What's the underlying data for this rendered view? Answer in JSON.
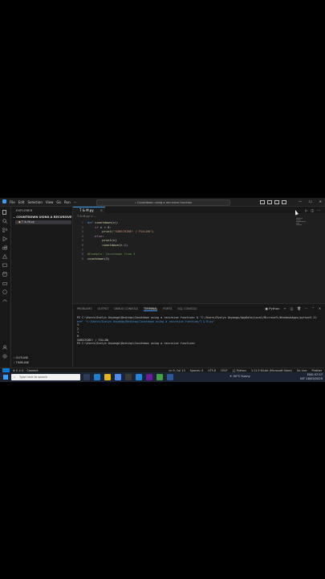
{
  "window": {
    "menu": [
      "File",
      "Edit",
      "Selection",
      "View",
      "Go",
      "Run",
      "···"
    ],
    "command_center": "Countdown using a recursive function",
    "controls": [
      "—",
      "☐",
      "✕"
    ]
  },
  "sidebar": {
    "title": "EXPLORER",
    "folder": "COUNTDOWN USING A RECURSIVE FUNCTI...",
    "file": "T & M.py",
    "outline": "OUTLINE",
    "timeline": "TIMELINE"
  },
  "editor": {
    "tab": "T & M.py",
    "tab_close": "×",
    "breadcrumb": "T & M.py > ...",
    "lines": [
      {
        "n": "1"
      },
      {
        "n": "2"
      },
      {
        "n": "3"
      },
      {
        "n": "4"
      },
      {
        "n": "5"
      },
      {
        "n": "6"
      },
      {
        "n": "7"
      },
      {
        "n": "8"
      },
      {
        "n": "9"
      }
    ],
    "code": {
      "l1_kw": "def ",
      "l1_fn": "countdown",
      "l1_rest": "(n):",
      "l2_kw": "if ",
      "l2_var": "n",
      "l2_op": " < ",
      "l2_num": "0",
      "l2_end": ":",
      "l3_fn": "print",
      "l3_open": "(",
      "l3_str": "\"SUBSCRIBE! / FOLLOW\"",
      "l3_close": ")",
      "l4_kw": "else",
      ":": ":",
      "l5_fn": "print",
      "l5_rest": "(n)",
      "l6_fn": "countdown",
      "l6_rest": "(n-1)",
      "l8_cm": "#Example: Countdown from 3",
      "l9_fn": "countdown",
      "l9_rest": "(3)"
    }
  },
  "panel": {
    "tabs": [
      "PROBLEMS",
      "OUTPUT",
      "DEBUG CONSOLE",
      "TERMINAL",
      "PORTS",
      "SQL CONSOLE"
    ],
    "active_tab": "TERMINAL",
    "shell": "Python",
    "terminal": [
      "PS C:\\Users\\Evelyn Onyango\\Desktop\\Countdown using a recursive function> & \"C:/Users/Evelyn Onyango/AppData/Local/Microsoft/WindowsApps/python3.11.",
      "exe\" \"c:/Users/Evelyn Onyango/Desktop/Countdown using a recursive function/T & M.py\"",
      "3",
      "2",
      "1",
      "0",
      "SUBSCRIBE! / FOLLOW",
      "PS C:\\Users\\Evelyn Onyango\\Desktop\\Countdown using a recursive function>"
    ]
  },
  "statusbar": {
    "left": [
      "⊗ 0 ⚠ 0",
      "Connect"
    ],
    "right": [
      "Ln 9, Col 13",
      "Spaces: 4",
      "UTF-8",
      "CRLF",
      "{} Python",
      "3.11.9 64-bit (Microsoft Store)",
      "Go Live",
      "Prettier"
    ]
  },
  "taskbar": {
    "search_placeholder": "Type here to search",
    "weather": "30°C Sunny",
    "lang": "ENG",
    "region": "INT",
    "time": "07:57",
    "date": "28/03/2025"
  },
  "colors": {
    "accent": "#3d9df3",
    "bg": "#1f1f1f",
    "sidebar": "#181818"
  }
}
